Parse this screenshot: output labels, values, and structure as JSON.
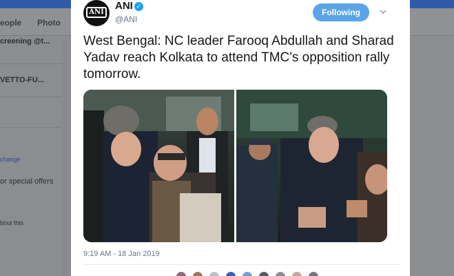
{
  "background": {
    "nav": [
      "eople",
      "Photo"
    ],
    "left_items": [
      "creening @t...",
      "VETTO-FU..."
    ],
    "left_link": "change",
    "left_text": "or special offers",
    "left_small": "bout this"
  },
  "tweet": {
    "author_name": "ANI",
    "author_handle": "@ANI",
    "avatar_text": "ANI",
    "follow_label": "Following",
    "text": "West Bengal: NC leader Farooq Abdullah and Sharad Yadav reach Kolkata to attend TMC's opposition rally tomorrow.",
    "timestamp": "9:19 AM - 18 Jan 2019"
  },
  "colors": {
    "brand": "#1da1f2",
    "follow_button": "#5ba4e8",
    "topbar": "#2f5ba8"
  },
  "icons": {
    "verified": "verified-badge-icon",
    "menu": "chevron-down-icon"
  }
}
